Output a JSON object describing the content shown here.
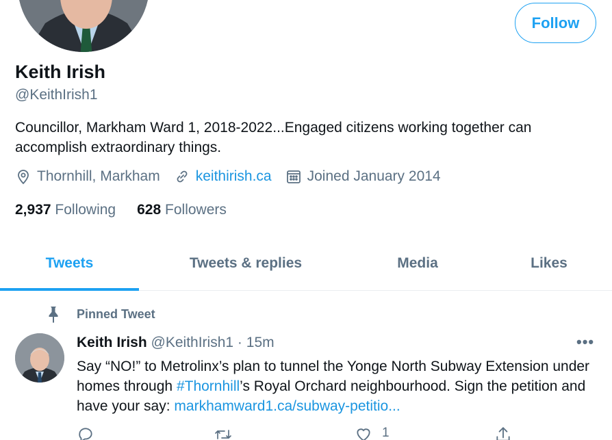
{
  "profile": {
    "name": "Keith Irish",
    "handle": "@KeithIrish1",
    "bio": "Councillor, Markham Ward 1, 2018-2022...Engaged citizens working together can accomplish extraordinary things.",
    "location": "Thornhill, Markham",
    "website": "keithirish.ca",
    "joined": "Joined January 2014",
    "following_count": "2,937",
    "following_label": "Following",
    "followers_count": "628",
    "followers_label": "Followers",
    "follow_button": "Follow"
  },
  "tabs": [
    {
      "label": "Tweets",
      "active": true
    },
    {
      "label": "Tweets & replies",
      "active": false
    },
    {
      "label": "Media",
      "active": false
    },
    {
      "label": "Likes",
      "active": false
    }
  ],
  "pinned_tweet": {
    "label": "Pinned Tweet",
    "author_name": "Keith Irish",
    "author_handle": "@KeithIrish1",
    "separator": "·",
    "time": "15m",
    "more": "•••",
    "text_part1": "Say “NO!” to Metrolinx’s plan to tunnel the Yonge North Subway Extension under homes through ",
    "hashtag": "#Thornhill",
    "text_part2": "’s Royal Orchard neighbourhood.  Sign the petition and have your say:  ",
    "link": "markhamward1.ca/subway-petitio...",
    "like_count": "1"
  },
  "icons": {
    "location": "location-pin-icon",
    "link": "link-icon",
    "calendar": "calendar-icon",
    "pin": "pin-icon",
    "reply": "reply-icon",
    "retweet": "retweet-icon",
    "like": "heart-icon",
    "share": "share-icon"
  },
  "colors": {
    "accent": "#1da1f2",
    "link": "#1b95e0",
    "secondary_text": "#5b7083",
    "primary_text": "#0f1419"
  }
}
